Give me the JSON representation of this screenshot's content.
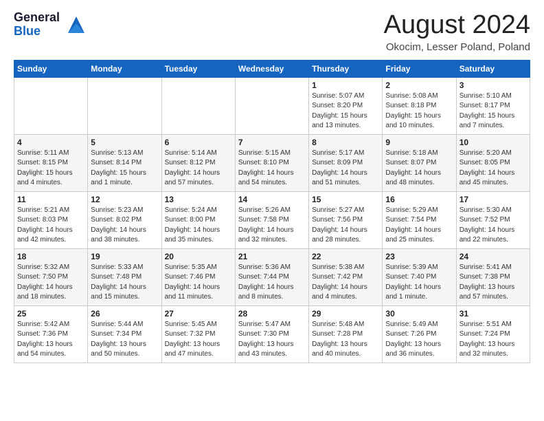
{
  "header": {
    "logo_general": "General",
    "logo_blue": "Blue",
    "month": "August 2024",
    "location": "Okocim, Lesser Poland, Poland"
  },
  "days_of_week": [
    "Sunday",
    "Monday",
    "Tuesday",
    "Wednesday",
    "Thursday",
    "Friday",
    "Saturday"
  ],
  "weeks": [
    [
      {
        "day": "",
        "detail": ""
      },
      {
        "day": "",
        "detail": ""
      },
      {
        "day": "",
        "detail": ""
      },
      {
        "day": "",
        "detail": ""
      },
      {
        "day": "1",
        "detail": "Sunrise: 5:07 AM\nSunset: 8:20 PM\nDaylight: 15 hours\nand 13 minutes."
      },
      {
        "day": "2",
        "detail": "Sunrise: 5:08 AM\nSunset: 8:18 PM\nDaylight: 15 hours\nand 10 minutes."
      },
      {
        "day": "3",
        "detail": "Sunrise: 5:10 AM\nSunset: 8:17 PM\nDaylight: 15 hours\nand 7 minutes."
      }
    ],
    [
      {
        "day": "4",
        "detail": "Sunrise: 5:11 AM\nSunset: 8:15 PM\nDaylight: 15 hours\nand 4 minutes."
      },
      {
        "day": "5",
        "detail": "Sunrise: 5:13 AM\nSunset: 8:14 PM\nDaylight: 15 hours\nand 1 minute."
      },
      {
        "day": "6",
        "detail": "Sunrise: 5:14 AM\nSunset: 8:12 PM\nDaylight: 14 hours\nand 57 minutes."
      },
      {
        "day": "7",
        "detail": "Sunrise: 5:15 AM\nSunset: 8:10 PM\nDaylight: 14 hours\nand 54 minutes."
      },
      {
        "day": "8",
        "detail": "Sunrise: 5:17 AM\nSunset: 8:09 PM\nDaylight: 14 hours\nand 51 minutes."
      },
      {
        "day": "9",
        "detail": "Sunrise: 5:18 AM\nSunset: 8:07 PM\nDaylight: 14 hours\nand 48 minutes."
      },
      {
        "day": "10",
        "detail": "Sunrise: 5:20 AM\nSunset: 8:05 PM\nDaylight: 14 hours\nand 45 minutes."
      }
    ],
    [
      {
        "day": "11",
        "detail": "Sunrise: 5:21 AM\nSunset: 8:03 PM\nDaylight: 14 hours\nand 42 minutes."
      },
      {
        "day": "12",
        "detail": "Sunrise: 5:23 AM\nSunset: 8:02 PM\nDaylight: 14 hours\nand 38 minutes."
      },
      {
        "day": "13",
        "detail": "Sunrise: 5:24 AM\nSunset: 8:00 PM\nDaylight: 14 hours\nand 35 minutes."
      },
      {
        "day": "14",
        "detail": "Sunrise: 5:26 AM\nSunset: 7:58 PM\nDaylight: 14 hours\nand 32 minutes."
      },
      {
        "day": "15",
        "detail": "Sunrise: 5:27 AM\nSunset: 7:56 PM\nDaylight: 14 hours\nand 28 minutes."
      },
      {
        "day": "16",
        "detail": "Sunrise: 5:29 AM\nSunset: 7:54 PM\nDaylight: 14 hours\nand 25 minutes."
      },
      {
        "day": "17",
        "detail": "Sunrise: 5:30 AM\nSunset: 7:52 PM\nDaylight: 14 hours\nand 22 minutes."
      }
    ],
    [
      {
        "day": "18",
        "detail": "Sunrise: 5:32 AM\nSunset: 7:50 PM\nDaylight: 14 hours\nand 18 minutes."
      },
      {
        "day": "19",
        "detail": "Sunrise: 5:33 AM\nSunset: 7:48 PM\nDaylight: 14 hours\nand 15 minutes."
      },
      {
        "day": "20",
        "detail": "Sunrise: 5:35 AM\nSunset: 7:46 PM\nDaylight: 14 hours\nand 11 minutes."
      },
      {
        "day": "21",
        "detail": "Sunrise: 5:36 AM\nSunset: 7:44 PM\nDaylight: 14 hours\nand 8 minutes."
      },
      {
        "day": "22",
        "detail": "Sunrise: 5:38 AM\nSunset: 7:42 PM\nDaylight: 14 hours\nand 4 minutes."
      },
      {
        "day": "23",
        "detail": "Sunrise: 5:39 AM\nSunset: 7:40 PM\nDaylight: 14 hours\nand 1 minute."
      },
      {
        "day": "24",
        "detail": "Sunrise: 5:41 AM\nSunset: 7:38 PM\nDaylight: 13 hours\nand 57 minutes."
      }
    ],
    [
      {
        "day": "25",
        "detail": "Sunrise: 5:42 AM\nSunset: 7:36 PM\nDaylight: 13 hours\nand 54 minutes."
      },
      {
        "day": "26",
        "detail": "Sunrise: 5:44 AM\nSunset: 7:34 PM\nDaylight: 13 hours\nand 50 minutes."
      },
      {
        "day": "27",
        "detail": "Sunrise: 5:45 AM\nSunset: 7:32 PM\nDaylight: 13 hours\nand 47 minutes."
      },
      {
        "day": "28",
        "detail": "Sunrise: 5:47 AM\nSunset: 7:30 PM\nDaylight: 13 hours\nand 43 minutes."
      },
      {
        "day": "29",
        "detail": "Sunrise: 5:48 AM\nSunset: 7:28 PM\nDaylight: 13 hours\nand 40 minutes."
      },
      {
        "day": "30",
        "detail": "Sunrise: 5:49 AM\nSunset: 7:26 PM\nDaylight: 13 hours\nand 36 minutes."
      },
      {
        "day": "31",
        "detail": "Sunrise: 5:51 AM\nSunset: 7:24 PM\nDaylight: 13 hours\nand 32 minutes."
      }
    ]
  ]
}
